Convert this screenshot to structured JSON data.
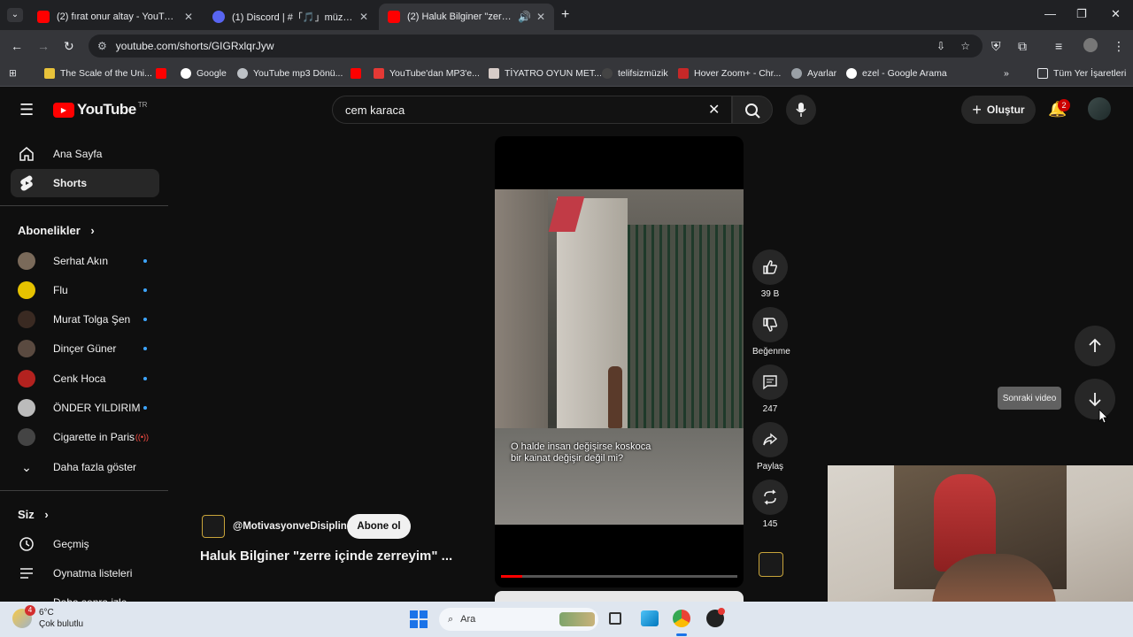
{
  "browser": {
    "tabs": [
      {
        "title": "(2) fırat onur altay - YouTube",
        "active": false
      },
      {
        "title": "(1) Discord | #「🎵」müzik-istek",
        "active": false
      },
      {
        "title": "(2) Haluk Bilginer \"zerre içinde",
        "active": true
      }
    ],
    "url": "youtube.com/shorts/GIGRxlqrJyw",
    "bookmarks": [
      "The Scale of the Uni...",
      "Google",
      "YouTube mp3 Dönü...",
      "YouTube'dan MP3'e...",
      "TİYATRO OYUN MET...",
      "telifsizmüzik",
      "Hover Zoom+ - Chr...",
      "Ayarlar",
      "ezel - Google Arama"
    ],
    "all_bookmarks": "Tüm Yer İşaretleri"
  },
  "youtube": {
    "logo": "YouTube",
    "country": "TR",
    "search_value": "cem karaca",
    "create_label": "Oluştur",
    "notif_count": "2"
  },
  "sidebar": {
    "home": "Ana Sayfa",
    "shorts": "Shorts",
    "subs_heading": "Abonelikler",
    "subscriptions": [
      {
        "name": "Serhat Akın",
        "color": "#7a6a5a"
      },
      {
        "name": "Flu",
        "color": "#e6c200"
      },
      {
        "name": "Murat Tolga Şen",
        "color": "#3a2a22"
      },
      {
        "name": "Dinçer Güner",
        "color": "#5a4a40"
      },
      {
        "name": "Cenk Hoca",
        "color": "#b3221f"
      },
      {
        "name": "ÖNDER YILDIRIM",
        "color": "#bbbbbb"
      },
      {
        "name": "Cigarette in Paris",
        "color": "#444444"
      }
    ],
    "more": "Daha fazla göster",
    "you_heading": "Siz",
    "history": "Geçmiş",
    "playlists": "Oynatma listeleri",
    "cut_item": "Daha sonra izle"
  },
  "short": {
    "caption_line1": "O halde insan değişirse koskoca",
    "caption_line2": "bir kainat değişir değil mi?",
    "channel": "@MotivasyonveDisiplin",
    "subscribe": "Abone ol",
    "title": "Haluk Bilginer \"zerre içinde zerreyim\" ...",
    "likes": "39 B",
    "dislike_label": "Beğenme",
    "comments": "247",
    "share_label": "Paylaş",
    "remix_count": "145",
    "next_tooltip": "Sonraki video",
    "progress": 0.09
  },
  "taskbar": {
    "temp": "6°C",
    "weather": "Çok bulutlu",
    "weather_badge": "4",
    "search_placeholder": "Ara"
  }
}
